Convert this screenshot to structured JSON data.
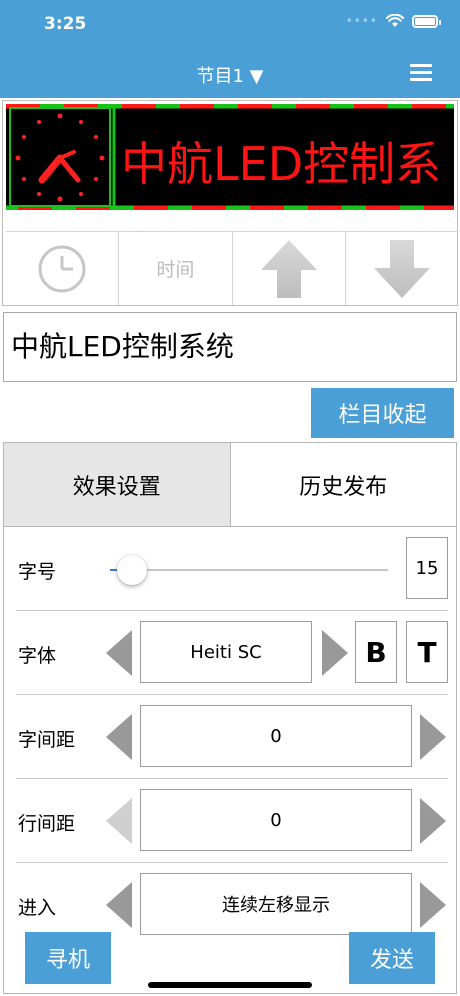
{
  "status_bar": {
    "time": "3:25",
    "icons": [
      "signal-dots",
      "wifi-icon",
      "battery-icon"
    ]
  },
  "nav": {
    "title": "节目1 ▼",
    "menu_icon": "hamburger-menu-icon"
  },
  "led_preview": {
    "text": "中航LED控制系",
    "text_color": "#ff1414",
    "background": "#000000",
    "border_colors": [
      "#ff0000",
      "#00cc00"
    ]
  },
  "toolbar": {
    "items": [
      {
        "icon": "clock-icon"
      },
      {
        "label": "时间"
      },
      {
        "icon": "up-arrow-icon"
      },
      {
        "icon": "down-arrow-icon"
      }
    ]
  },
  "text_input": {
    "value": "中航LED控制系统"
  },
  "collapse_button": {
    "label": "栏目收起"
  },
  "tabs": [
    {
      "label": "效果设置",
      "active": true
    },
    {
      "label": "历史发布",
      "active": false
    }
  ],
  "settings": {
    "font_size": {
      "label": "字号",
      "value": "15",
      "slider_fraction": 0.08
    },
    "font_family": {
      "label": "字体",
      "value": "Heiti SC",
      "bold_label": "B",
      "italic_label": "T"
    },
    "char_spacing": {
      "label": "字间距",
      "value": "0"
    },
    "line_spacing": {
      "label": "行间距",
      "value": "0"
    },
    "enter_effect": {
      "label": "进入",
      "value": "连续左移显示"
    }
  },
  "bottom": {
    "search_label": "寻机",
    "send_label": "发送"
  },
  "colors": {
    "accent": "#4aa0d6"
  }
}
